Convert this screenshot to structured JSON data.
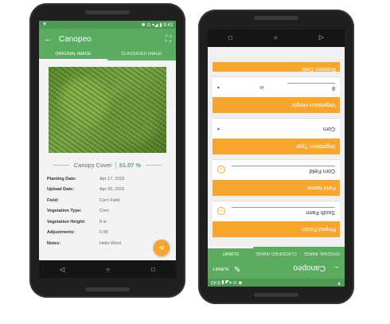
{
  "left": {
    "status": {
      "time": "9:43"
    },
    "app_title": "Canopeo",
    "tabs": [
      "ORIGINAL IMAGE",
      "CLASSIFIED IMAGE"
    ],
    "cover_label": "Canopy Cover",
    "cover_value": "51.07 %",
    "rows": [
      {
        "k": "Planting Date:",
        "v": "Apr 17, 2015"
      },
      {
        "k": "Upload Date:",
        "v": "Apr 20, 2015"
      },
      {
        "k": "Field:",
        "v": "Corn Field"
      },
      {
        "k": "Vegetation Type:",
        "v": "Corn"
      },
      {
        "k": "Vegetation Height:",
        "v": "8 in"
      },
      {
        "k": "Adjustments:",
        "v": "0.95"
      },
      {
        "k": "Notes:",
        "v": "Hello Word"
      }
    ],
    "nav": [
      "◁",
      "○",
      "□"
    ]
  },
  "right": {
    "status": {
      "time": "9:43"
    },
    "app_title": "Canopeo",
    "submit_label": "SUBMIT",
    "tabs": [
      "ORIGINAL IMAGE",
      "CLASSIFIED IMAGE",
      "SUBMIT"
    ],
    "project_folder_label": "Project Folder",
    "project_folder_value": "South Farm",
    "field_name_label": "Field Name",
    "field_name_value": "Corn Field",
    "vegetation_type_label": "Vegetation Type",
    "vegetation_type_value": "Corn",
    "vegetation_height_label": "Vegetation Height",
    "vegetation_height_value": "8",
    "vegetation_height_unit": "in",
    "rotation_date_label": "Rotation Date",
    "nav": [
      "◁",
      "○",
      "□"
    ]
  },
  "colors": {
    "green": "#5bab60",
    "orange": "#f7a52c"
  }
}
